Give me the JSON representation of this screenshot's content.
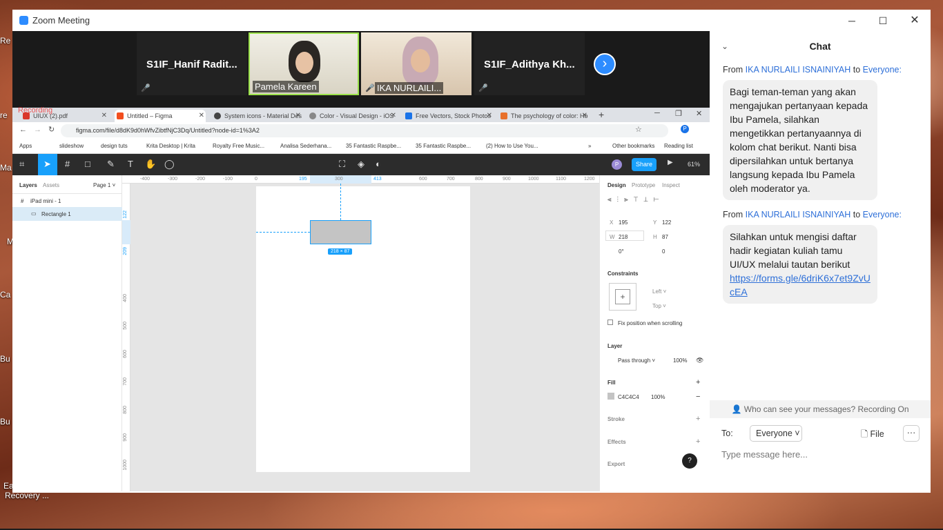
{
  "desktop": {
    "icons": [
      "Re",
      "re",
      "Ma",
      "M",
      "Ca",
      "Bu",
      "Bu",
      "Ea"
    ],
    "bottom_label": "Recovery ..."
  },
  "window": {
    "title": "Zoom Meeting",
    "min": "─",
    "max": "☐",
    "close": "✕"
  },
  "participants": [
    {
      "name": "S1IF_Hanif  Radit...",
      "muted": true
    },
    {
      "name": "Pamela Kareen",
      "muted": false
    },
    {
      "name": "IKA NURLAILI...",
      "muted": true
    },
    {
      "name": "S1IF_Adithya  Kh...",
      "muted": true
    }
  ],
  "next_button": "›",
  "browser": {
    "recording": "Recording",
    "tabs": [
      "UIUX (2).pdf",
      "Untitled – Figma",
      "System icons - Material Des",
      "Color - Visual Design - iOS",
      "Free Vectors, Stock Photos",
      "The psychology of color: Ho"
    ],
    "url": "figma.com/file/d8dK9d0hWfvZibtfNjC3Dq/Untitled?node-id=1%3A2",
    "bookmarks": [
      "Apps",
      "slideshow",
      "design tuts",
      "Krita Desktop | Krita",
      "Royalty Free Music...",
      "Analisa Sederhana...",
      "35 Fantastic Raspbe...",
      "35 Fantastic Raspbe...",
      "(2) How to Use You...",
      "»",
      "Other bookmarks",
      "Reading list"
    ]
  },
  "figma": {
    "share": "Share",
    "zoom": "61%",
    "avatar": "P",
    "layers_tab": "Layers",
    "assets_tab": "Assets",
    "page": "Page 1 ˅",
    "frame_layer": "iPad mini - 1",
    "rect_layer": "Rectangle 1",
    "ruler": [
      "-400",
      "-300",
      "-200",
      "-100",
      "0",
      "195",
      "300",
      "413",
      "600",
      "700",
      "800",
      "900",
      "1000",
      "1100",
      "1200"
    ],
    "vruler": [
      "122",
      "209",
      "400",
      "500",
      "600",
      "700",
      "800",
      "900",
      "1000"
    ],
    "size_badge": "218 × 87",
    "design_tabs": [
      "Design",
      "Prototype",
      "Inspect"
    ],
    "x": "195",
    "y": "122",
    "w": "218",
    "h": "87",
    "rotation": "0°",
    "radius": "0",
    "constraints": "Constraints",
    "c_left": "Left ˅",
    "c_top": "Top ˅",
    "fix_scroll": "Fix position when scrolling",
    "layer": "Layer",
    "blend": "Pass through ˅",
    "layer_opacity": "100%",
    "fill": "Fill",
    "fill_hex": "C4C4C4",
    "fill_opacity": "100%",
    "stroke": "Stroke",
    "effects": "Effects",
    "export": "Export",
    "help": "?",
    "fill_color": "#c4c4c4",
    "accent": "#18a0fb"
  },
  "chat": {
    "title": "Chat",
    "messages": [
      {
        "from": "From",
        "sender": "IKA NURLAILI ISNAINIYAH",
        "to": "to",
        "recipient": "Everyone:",
        "text": "Bagi teman-teman yang akan mengajukan pertanyaan kepada Ibu Pamela, silahkan mengetikkan pertanyaannya di kolom chat berikut. Nanti bisa dipersilahkan untuk bertanya langsung kepada Ibu Pamela oleh moderator ya."
      },
      {
        "from": "From",
        "sender": "IKA NURLAILI ISNAINIYAH",
        "to": "to",
        "recipient": "Everyone:",
        "text": "Silahkan untuk mengisi daftar hadir kegiatan kuliah tamu UI/UX melalui tautan berikut",
        "link": "https://forms.gle/6driK6x7et9ZvUcEA"
      }
    ],
    "who_can_see": "Who can see your messages? Recording On",
    "to_label": "To:",
    "recipient_select": "Everyone ˅",
    "file": "File",
    "more": "···",
    "placeholder": "Type message here..."
  }
}
